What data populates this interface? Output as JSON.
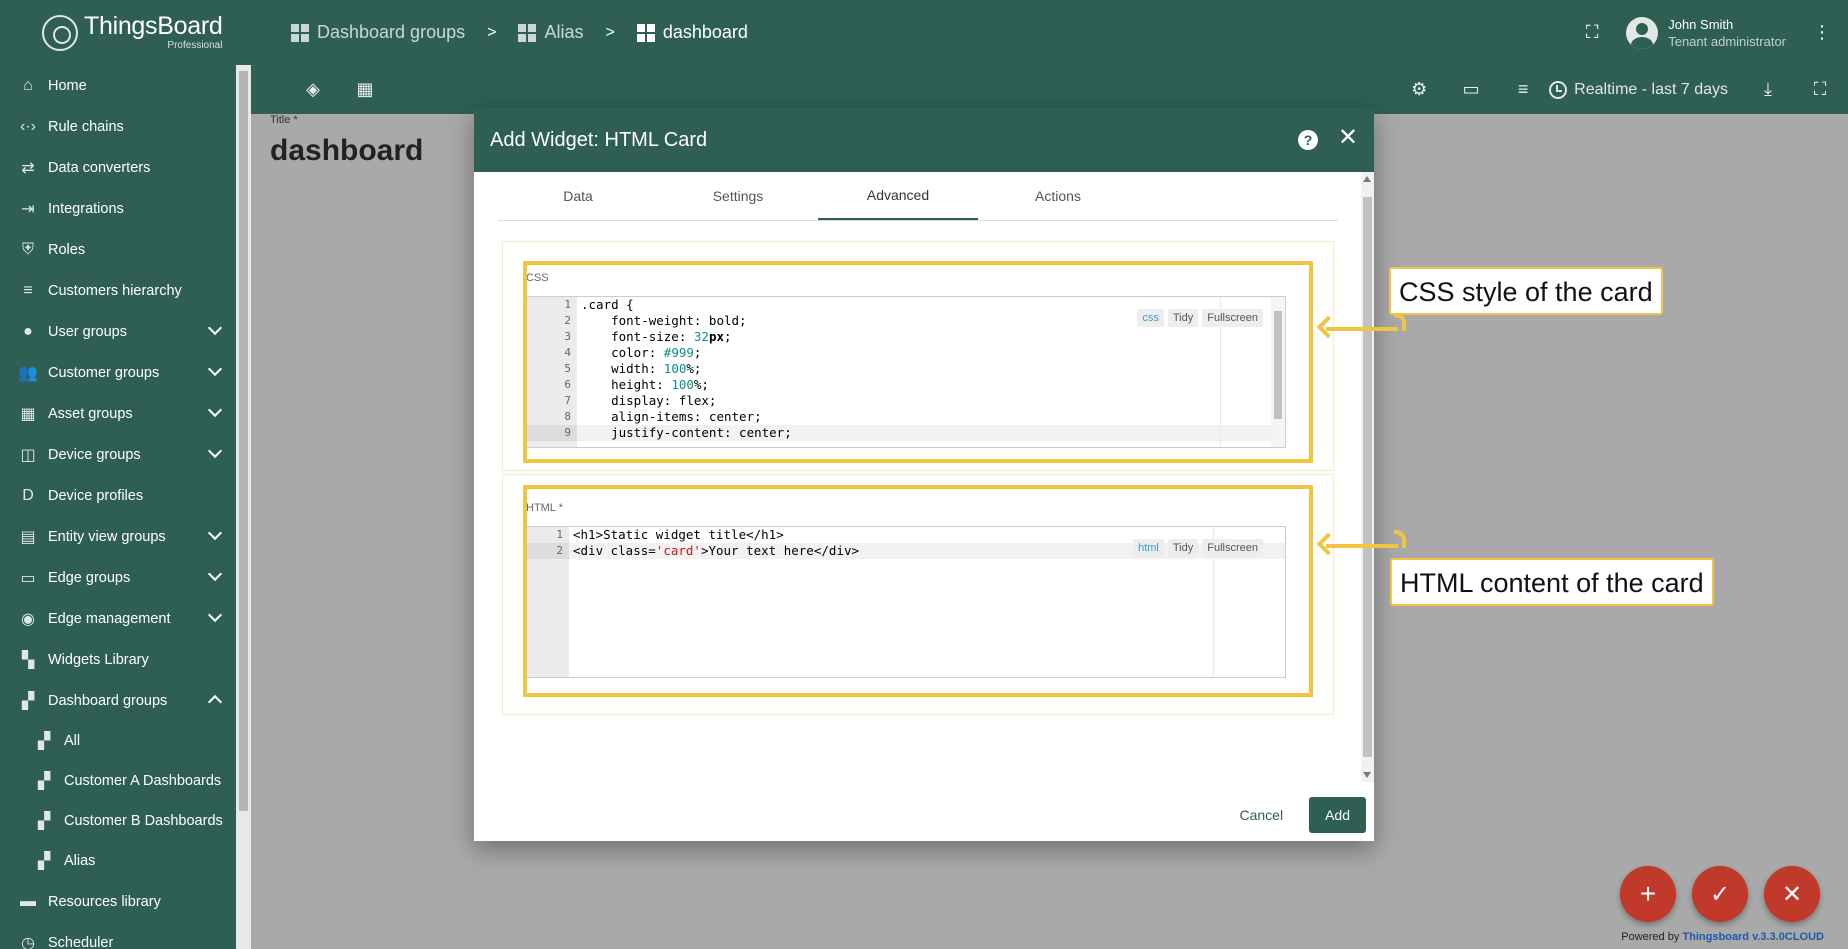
{
  "brand": {
    "name": "ThingsBoard",
    "sub": "Professional"
  },
  "sidebar": {
    "items": [
      {
        "label": "Home",
        "icon": "home-icon",
        "glyph": "⌂"
      },
      {
        "label": "Rule chains",
        "icon": "rule-chain-icon",
        "glyph": "‹·›"
      },
      {
        "label": "Data converters",
        "icon": "converter-icon",
        "glyph": "⇄"
      },
      {
        "label": "Integrations",
        "icon": "integration-icon",
        "glyph": "⇥"
      },
      {
        "label": "Roles",
        "icon": "shield-icon",
        "glyph": "⛨"
      },
      {
        "label": "Customers hierarchy",
        "icon": "hierarchy-icon",
        "glyph": "≡"
      },
      {
        "label": "User groups",
        "icon": "account-circle-icon",
        "glyph": "●",
        "expand": "down"
      },
      {
        "label": "Customer groups",
        "icon": "people-icon",
        "glyph": "👥",
        "expand": "down"
      },
      {
        "label": "Asset groups",
        "icon": "domain-icon",
        "glyph": "▦",
        "expand": "down"
      },
      {
        "label": "Device groups",
        "icon": "devices-icon",
        "glyph": "◫",
        "expand": "down"
      },
      {
        "label": "Device profiles",
        "icon": "device-profile-icon",
        "glyph": "D"
      },
      {
        "label": "Entity view groups",
        "icon": "view-quilt-icon",
        "glyph": "▤",
        "expand": "down"
      },
      {
        "label": "Edge groups",
        "icon": "router-icon",
        "glyph": "▭",
        "expand": "down"
      },
      {
        "label": "Edge management",
        "icon": "wifi-tethering-icon",
        "glyph": "◉",
        "expand": "down"
      },
      {
        "label": "Widgets Library",
        "icon": "widgets-icon",
        "glyph": "▚"
      },
      {
        "label": "Dashboard groups",
        "icon": "dashboard-icon",
        "glyph": "▞",
        "expand": "up"
      }
    ],
    "subitems": [
      {
        "label": "All"
      },
      {
        "label": "Customer A Dashboards"
      },
      {
        "label": "Customer B Dashboards"
      },
      {
        "label": "Alias"
      }
    ],
    "bottom": [
      {
        "label": "Resources library",
        "icon": "folder-icon",
        "glyph": "▬"
      },
      {
        "label": "Scheduler",
        "icon": "schedule-icon",
        "glyph": "◷"
      }
    ]
  },
  "header": {
    "breadcrumbs": [
      "Dashboard groups",
      "Alias",
      "dashboard"
    ],
    "separator": ">",
    "user_name": "John Smith",
    "user_role": "Tenant administrator"
  },
  "toolbar": {
    "time_window": "Realtime - last 7 days"
  },
  "dashboard": {
    "title_label": "Title *",
    "title": "dashboard"
  },
  "dialog": {
    "title": "Add Widget: HTML Card",
    "tabs": [
      "Data",
      "Settings",
      "Advanced",
      "Actions"
    ],
    "active_tab": "Advanced",
    "css_label": "CSS",
    "css_mode": "css",
    "html_label": "HTML *",
    "html_mode": "html",
    "tidy_label": "Tidy",
    "fullscreen_label": "Fullscreen",
    "cancel_label": "Cancel",
    "add_label": "Add"
  },
  "css_lines": [
    [
      {
        "t": ".card {"
      }
    ],
    [
      {
        "t": "    font-weight: bold;"
      }
    ],
    [
      {
        "t": "    font-size: "
      },
      {
        "t": "32",
        "c": "num"
      },
      {
        "t": "px",
        "c": "unit"
      },
      {
        "t": ";"
      }
    ],
    [
      {
        "t": "    color: "
      },
      {
        "t": "#999",
        "c": "hexc"
      },
      {
        "t": ";"
      }
    ],
    [
      {
        "t": "    width: "
      },
      {
        "t": "100",
        "c": "num"
      },
      {
        "t": "%;"
      }
    ],
    [
      {
        "t": "    height: "
      },
      {
        "t": "100",
        "c": "num"
      },
      {
        "t": "%;"
      }
    ],
    [
      {
        "t": "    display: flex;"
      }
    ],
    [
      {
        "t": "    align-items: center;"
      }
    ],
    [
      {
        "t": "    justify-content: center;"
      }
    ]
  ],
  "html_lines": [
    [
      {
        "t": "<h1>Static widget title</h1>"
      }
    ],
    [
      {
        "t": "<div class="
      },
      {
        "t": "'card'",
        "c": "str"
      },
      {
        "t": ">Your text here</div>"
      }
    ]
  ],
  "callouts": {
    "css": "CSS style of the card",
    "html": "HTML content of the card"
  },
  "footer": {
    "powered_prefix": "Powered by",
    "powered_link": "Thingsboard v.3.3.0CLOUD"
  },
  "colors": {
    "primary": "#2f5f53",
    "accent": "#c0392b",
    "callout": "#f0c542"
  }
}
